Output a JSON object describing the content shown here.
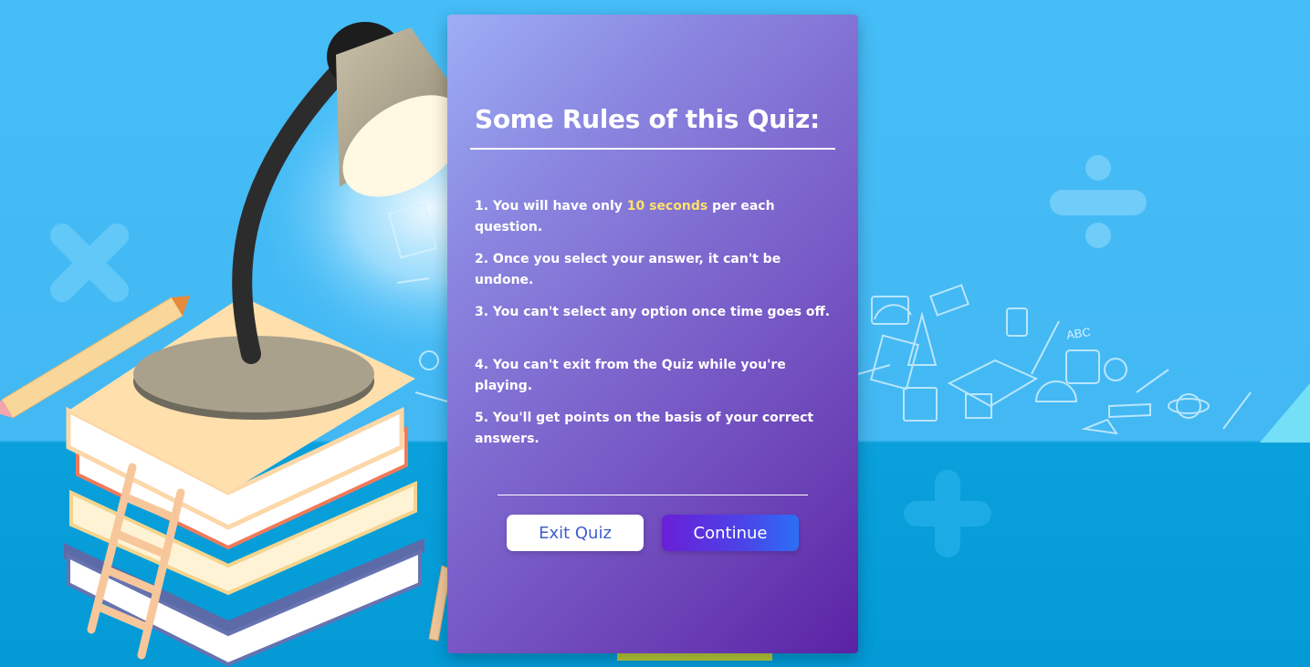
{
  "rules_card": {
    "title": "Some Rules of this Quiz:",
    "rules": [
      {
        "before": "1. You will have only ",
        "highlight": "10 seconds",
        "after": " per each question."
      },
      {
        "text": "2. Once you select your answer, it can't be undone."
      },
      {
        "text": "3. You can't select any option once time goes off."
      },
      {
        "text": "4. You can't exit from the Quiz while you're playing."
      },
      {
        "text": "5. You'll get points on the basis of your correct answers."
      }
    ],
    "buttons": {
      "exit_label": "Exit Quiz",
      "continue_label": "Continue"
    }
  },
  "decorations": {
    "doodle_text": "ABC",
    "icons": [
      "multiply-icon",
      "divide-icon",
      "plus-icon",
      "desk-lamp-illustration",
      "book-stack-illustration",
      "pencil-illustration",
      "ladder-illustration"
    ]
  },
  "colors": {
    "highlight": "#ffe26b",
    "card_gradient_start": "#9daef5",
    "card_gradient_end": "#5a22a5",
    "exit_text": "#3f5cc8",
    "continue_gradient_start": "#6a1fd6",
    "continue_gradient_end": "#2b6ff6"
  }
}
